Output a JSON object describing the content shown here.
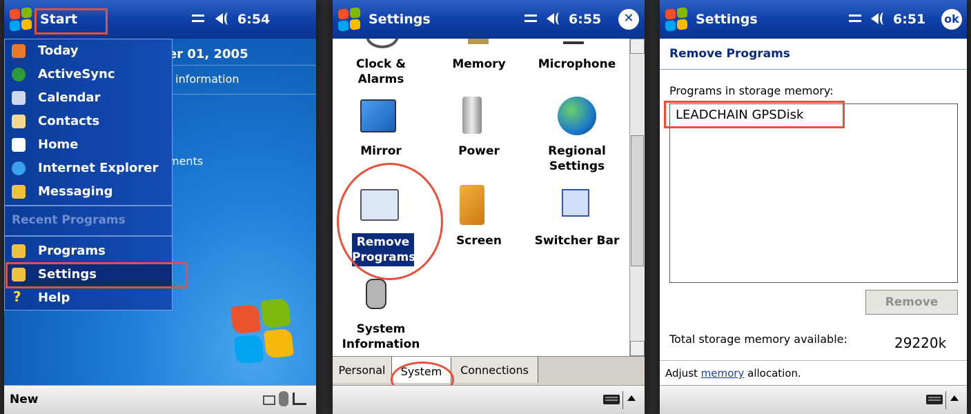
{
  "panel1": {
    "title": "Start",
    "time": "6:54",
    "today_date": "er 01, 2005",
    "today_info": "· information",
    "today_appts": "ments",
    "menu": [
      {
        "label": "Today",
        "color": "#e87a2a"
      },
      {
        "label": "ActiveSync",
        "color": "#2e9a3a"
      },
      {
        "label": "Calendar",
        "color": "#d0d8f0"
      },
      {
        "label": "Contacts",
        "color": "#f0d890"
      },
      {
        "label": "Home",
        "color": "#ffffff"
      },
      {
        "label": "Internet Explorer",
        "color": "#3aa0f0"
      },
      {
        "label": "Messaging",
        "color": "#f0c040"
      }
    ],
    "recent_label": "Recent Programs",
    "bottom_menu": [
      {
        "label": "Programs",
        "color": "#f0c040"
      },
      {
        "label": "Settings",
        "color": "#f0c040"
      },
      {
        "label": "Help",
        "color": "#f0e040"
      }
    ],
    "help_glyph": "?",
    "new_label": "New"
  },
  "panel2": {
    "title": "Settings",
    "time": "6:55",
    "close_glyph": "✕",
    "items": [
      {
        "label": "Clock & Alarms",
        "icon": "clock-icon"
      },
      {
        "label": "Memory",
        "icon": "memory-icon"
      },
      {
        "label": "Microphone",
        "icon": "microphone-icon"
      },
      {
        "label": "Mirror",
        "icon": "mirror-icon"
      },
      {
        "label": "Power",
        "icon": "power-icon"
      },
      {
        "label": "Regional Settings",
        "icon": "globe-icon"
      },
      {
        "label": "Remove Programs",
        "icon": "remove-programs-icon"
      },
      {
        "label": "Screen",
        "icon": "screen-icon"
      },
      {
        "label": "Switcher Bar",
        "icon": "switcher-bar-icon"
      },
      {
        "label": "System Information",
        "icon": "system-info-icon"
      }
    ],
    "tabs": [
      "Personal",
      "System",
      "Connections"
    ],
    "active_tab": "System"
  },
  "panel3": {
    "title": "Settings",
    "time": "6:51",
    "ok_label": "ok",
    "section_title": "Remove Programs",
    "list_label": "Programs in storage memory:",
    "programs": [
      "LEADCHAIN GPSDisk"
    ],
    "remove_label": "Remove",
    "total_label": "Total storage memory available:",
    "total_value": "29220k",
    "adjust_prefix": "Adjust ",
    "adjust_link": "memory",
    "adjust_suffix": " allocation."
  },
  "colors": {
    "titlebar": "#0d3fa6",
    "highlight": "#e8503a",
    "menu_bg": "#0b3c9a"
  }
}
